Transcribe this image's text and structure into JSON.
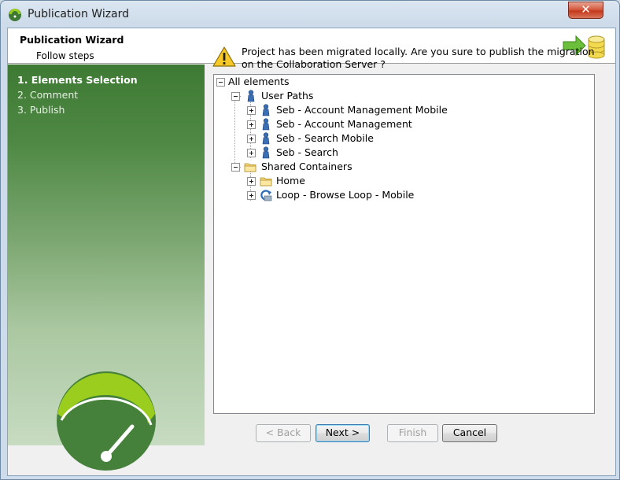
{
  "window": {
    "title": "Publication Wizard",
    "close_label": "x"
  },
  "header": {
    "title": "Publication Wizard",
    "subtitle": "Follow steps"
  },
  "steps": [
    {
      "label": "1. Elements Selection",
      "active": true
    },
    {
      "label": "2. Comment",
      "active": false
    },
    {
      "label": "3. Publish",
      "active": false
    }
  ],
  "message": "Project has been migrated locally. Are you sure to publish the migration on the Collaboration Server ?",
  "tree": {
    "root": "All elements",
    "user_paths": {
      "label": "User Paths",
      "items": [
        "Seb - Account Management Mobile",
        "Seb - Account Management",
        "Seb - Search Mobile",
        "Seb - Search"
      ]
    },
    "shared_containers": {
      "label": "Shared Containers",
      "items": [
        "Home",
        "Loop - Browse Loop - Mobile"
      ]
    }
  },
  "buttons": {
    "back": "< Back",
    "next": "Next >",
    "finish": "Finish",
    "cancel": "Cancel"
  },
  "colors": {
    "brand_green": "#3f7a35",
    "accent_lime": "#9acd1e",
    "close_red": "#c4391c"
  },
  "icons": [
    "app-logo-icon",
    "close-icon",
    "publish-database-icon",
    "warning-icon",
    "user-icon",
    "folder-icon",
    "loop-icon",
    "gauge-logo-icon"
  ]
}
